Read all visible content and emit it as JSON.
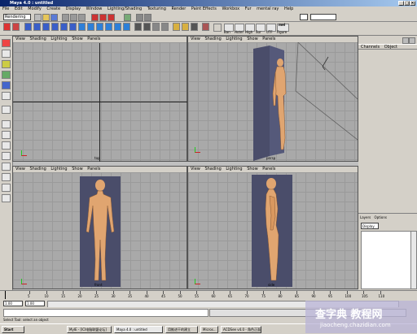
{
  "window": {
    "title": "Maya 4.0 : untitled"
  },
  "menubar": [
    "File",
    "Edit",
    "Modify",
    "Create",
    "Display",
    "Window",
    "Lighting/Shading",
    "Texturing",
    "Render",
    "Paint Effects",
    "Workbox",
    "Fur",
    "mental ray",
    "Help"
  ],
  "status": {
    "mode": "Rendering"
  },
  "shelf": {
    "labels": [
      "Ban",
      "Hotel",
      "High",
      "Sur",
      "UTF",
      "Figure"
    ],
    "corner": "mel"
  },
  "viewports": [
    {
      "menu": [
        "View",
        "Shading",
        "Lighting",
        "Show",
        "Panels"
      ],
      "camera": "top"
    },
    {
      "menu": [
        "View",
        "Shading",
        "Lighting",
        "Show",
        "Panels"
      ],
      "camera": "persp"
    },
    {
      "menu": [
        "View",
        "Shading",
        "Lighting",
        "Show",
        "Panels"
      ],
      "camera": "front"
    },
    {
      "menu": [
        "View",
        "Shading",
        "Lighting",
        "Show",
        "Panels"
      ],
      "camera": "side"
    }
  ],
  "channelbox": {
    "tabs": [
      "Channels",
      "Object"
    ]
  },
  "layers": {
    "tabs": [
      "Layers",
      "Options"
    ],
    "mode": "Display"
  },
  "timeline": {
    "ticks": [
      "5",
      "10",
      "15",
      "20",
      "25",
      "30",
      "35",
      "40",
      "45",
      "50",
      "55",
      "60",
      "65",
      "70",
      "75",
      "80",
      "85",
      "90",
      "95",
      "100",
      "105",
      "110"
    ]
  },
  "range": {
    "start": "1.00",
    "end": "1.00"
  },
  "help": "Select Tool: select an object",
  "taskbar": {
    "start": "Start",
    "tasks": [
      "MyIE - [ICI电脑联盟论坛]",
      "Maya 4.0 : untitled",
      "用推进干的建立",
      "Micros...",
      "ACDSee v4.0 - 角色正面"
    ]
  },
  "watermark": {
    "title": "查字典 教程网",
    "url": "jiaocheng.chazidian.com"
  },
  "colors": {
    "titlebar": "#0a246a",
    "panel": "#d4d0c8",
    "viewport": "#a9a9a9",
    "card": "#4a4d6a",
    "skin": "#e0a570"
  }
}
